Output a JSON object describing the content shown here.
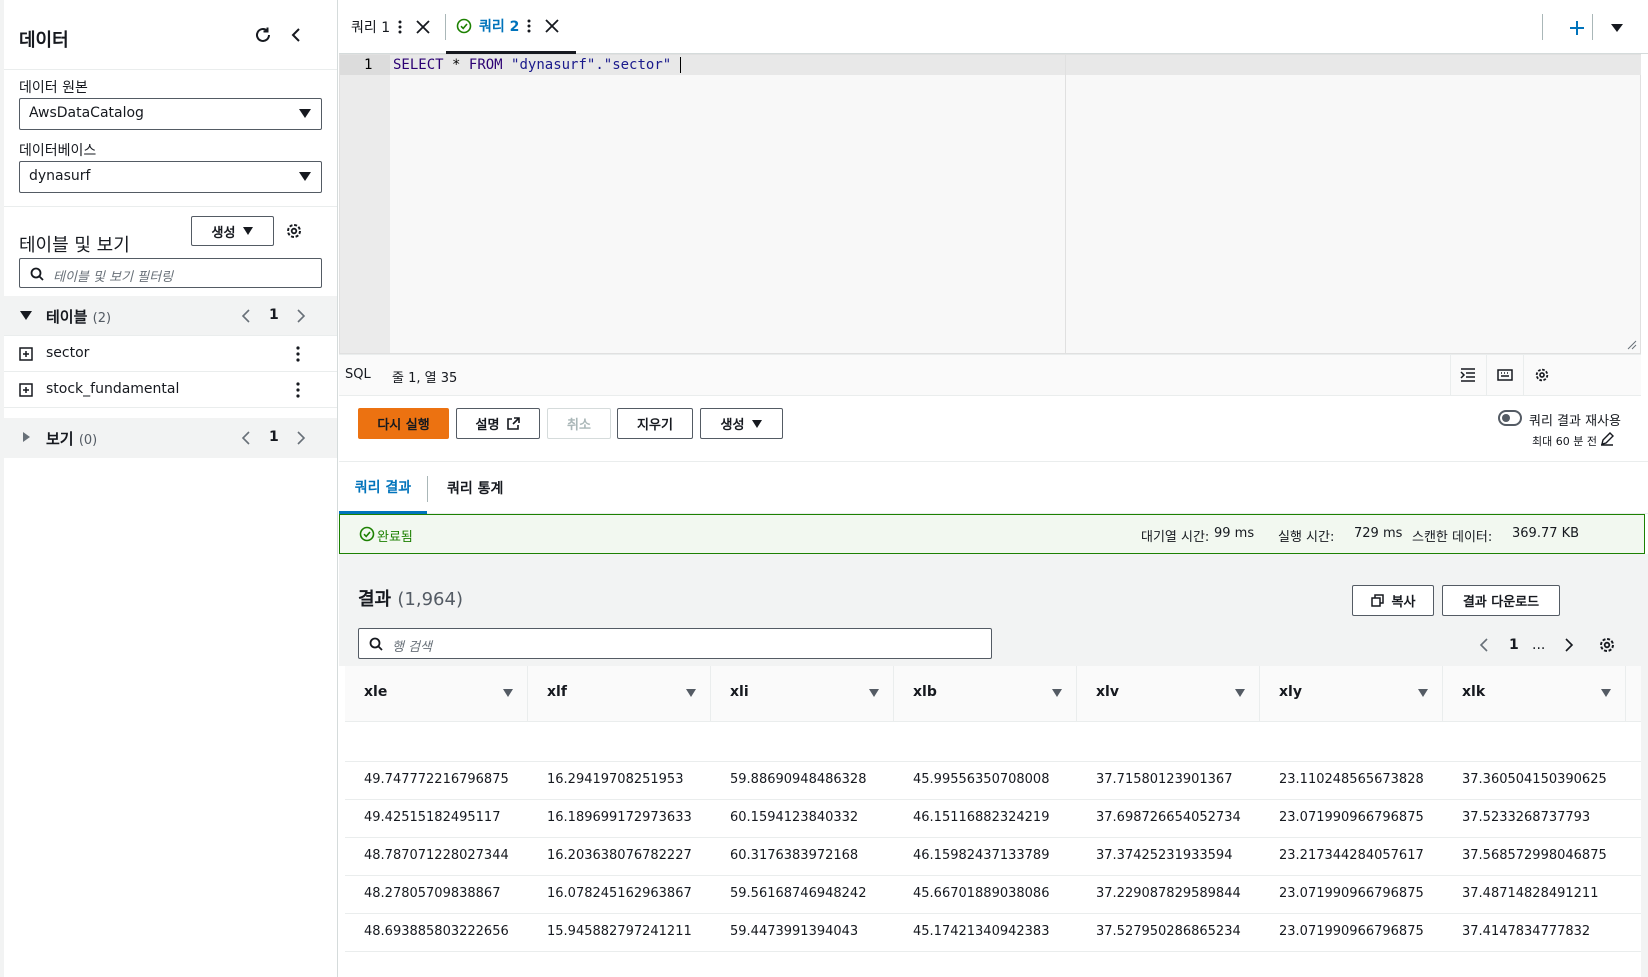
{
  "left": {
    "title": "데이터",
    "data_source_label": "데이터 원본",
    "data_source_value": "AwsDataCatalog",
    "database_label": "데이터베이스",
    "database_value": "dynasurf",
    "tables_views_title": "테이블 및 보기",
    "create_label": "생성",
    "filter_placeholder": "테이블 및 보기 필터링",
    "tables_label": "테이블",
    "tables_count": "(2)",
    "tables_page": "1",
    "tables": [
      "sector",
      "stock_fundamental"
    ],
    "views_label": "보기",
    "views_count": "(0)",
    "views_page": "1"
  },
  "tabs": [
    {
      "label": "쿼리 1"
    },
    {
      "label": "쿼리 2"
    }
  ],
  "editor": {
    "line_number": "1",
    "code_keyword_select": "SELECT",
    "code_star": "*",
    "code_keyword_from": "FROM",
    "code_table": "\"dynasurf\".\"sector\""
  },
  "status": {
    "mode": "SQL",
    "position": "줄 1, 열 35"
  },
  "toolbar": {
    "rerun": "다시 실행",
    "explain": "설명",
    "cancel": "취소",
    "clear": "지우기",
    "create": "생성",
    "reuse_label": "쿼리 결과 재사용",
    "reuse_sub": "최대 60 분 전"
  },
  "result_tabs": [
    "쿼리 결과",
    "쿼리 통계"
  ],
  "success": {
    "message": "완료됨",
    "queue_label": "대기열 시간:",
    "queue_value": "99 ms",
    "exec_label": "실행 시간:",
    "exec_value": "729 ms",
    "scanned_label": "스캔한 데이터:",
    "scanned_value": "369.77 KB"
  },
  "results": {
    "title": "결과",
    "count": "(1,964)",
    "copy": "복사",
    "download": "결과 다운로드",
    "search_placeholder": "행 검색",
    "page": "1",
    "ellipsis": "..."
  },
  "table": {
    "columns": [
      "xle",
      "xlf",
      "xli",
      "xlb",
      "xlv",
      "xly",
      "xlk"
    ],
    "rows": [
      [
        "",
        "",
        "",
        "",
        "",
        "",
        ""
      ],
      [
        "49.747772216796875",
        "16.29419708251953",
        "59.88690948486328",
        "45.99556350708008",
        "37.71580123901367",
        "23.110248565673828",
        "37.360504150390625"
      ],
      [
        "49.42515182495117",
        "16.189699172973633",
        "60.1594123840332",
        "46.15116882324219",
        "37.698726654052734",
        "23.071990966796875",
        "37.5233268737793"
      ],
      [
        "48.787071228027344",
        "16.203638076782227",
        "60.3176383972168",
        "46.15982437133789",
        "37.37425231933594",
        "23.217344284057617",
        "37.568572998046875"
      ],
      [
        "48.27805709838867",
        "16.078245162963867",
        "59.56168746948242",
        "45.66701889038086",
        "37.229087829589844",
        "23.071990966796875",
        "37.48714828491211"
      ],
      [
        "48.693885803222656",
        "15.945882797241211",
        "59.4473991394043",
        "45.17421340942383",
        "37.527950286865234",
        "23.071990966796875",
        "37.4147834777832"
      ]
    ]
  },
  "colors": {
    "primary": "#ec7211",
    "link": "#0073bb",
    "success": "#1d8102",
    "text": "#16191f"
  }
}
